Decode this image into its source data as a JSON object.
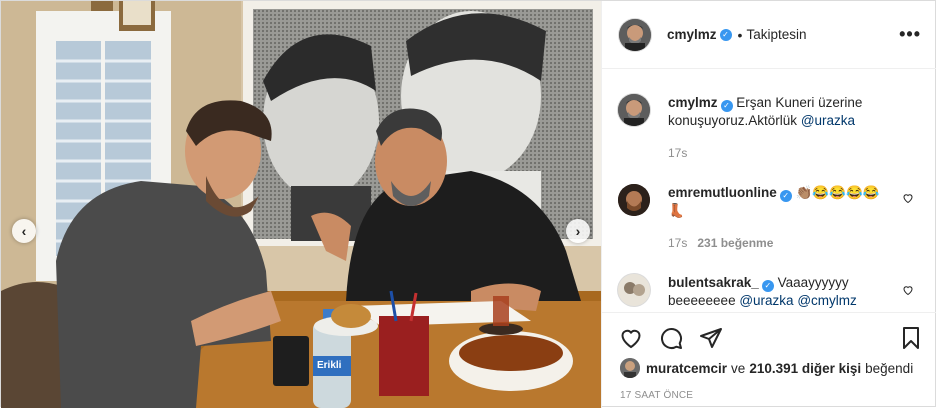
{
  "header": {
    "username": "cmylmz",
    "verified": true,
    "follow_status": "Takiptesin",
    "separator": "•",
    "more_icon": "•••"
  },
  "photo": {
    "nav_prev_icon": "‹",
    "nav_next_icon": "›",
    "bottle_label": "Erikli"
  },
  "comments": [
    {
      "username": "cmylmz",
      "text": "Erşan Kuneri üzerine konuşuyoruz.Aktörlük",
      "mention": "@urazka",
      "time": "17s",
      "likes": ""
    },
    {
      "username": "emremutluonline",
      "text": "👏🏽😂😂😂😂",
      "extra_icon": "👢",
      "time": "17s",
      "likes": "231 beğenme"
    },
    {
      "username": "bulentsakrak_",
      "text": "Vaaayyyyyy beeeeeeee",
      "mention1": "@urazka",
      "mention2": "@cmylmz"
    }
  ],
  "likes": {
    "user": "muratcemcir",
    "connector": "ve",
    "count": "210.391 diğer kişi",
    "suffix": "beğendi"
  },
  "timestamp": "17 SAAT ÖNCE",
  "colors": {
    "verified": "#3897f0",
    "mention": "#00376b",
    "muted": "#8e8e8e",
    "border": "#dbdbdb"
  }
}
